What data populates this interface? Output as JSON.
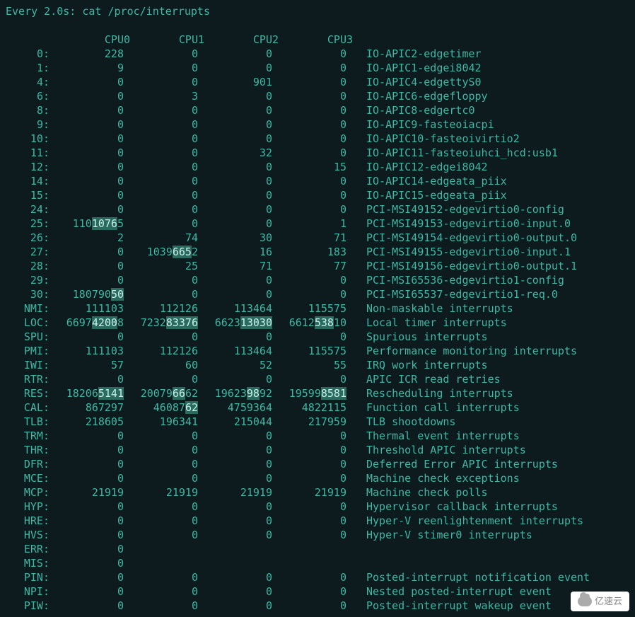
{
  "header": "Every 2.0s: cat /proc/interrupts",
  "cpu_headers": [
    "CPU0",
    "CPU1",
    "CPU2",
    "CPU3"
  ],
  "rows": [
    {
      "label": "0:",
      "cpu": [
        {
          "t": "228"
        },
        {
          "t": "0"
        },
        {
          "t": "0"
        },
        {
          "t": "0"
        }
      ],
      "src": "IO-APIC",
      "edge": "2-edge",
      "dev": "timer"
    },
    {
      "label": "1:",
      "cpu": [
        {
          "t": "9"
        },
        {
          "t": "0"
        },
        {
          "t": "0"
        },
        {
          "t": "0"
        }
      ],
      "src": "IO-APIC",
      "edge": "1-edge",
      "dev": "i8042"
    },
    {
      "label": "4:",
      "cpu": [
        {
          "t": "0"
        },
        {
          "t": "0"
        },
        {
          "t": "901"
        },
        {
          "t": "0"
        }
      ],
      "src": "IO-APIC",
      "edge": "4-edge",
      "dev": "ttyS0"
    },
    {
      "label": "6:",
      "cpu": [
        {
          "t": "0"
        },
        {
          "t": "3"
        },
        {
          "t": "0"
        },
        {
          "t": "0"
        }
      ],
      "src": "IO-APIC",
      "edge": "6-edge",
      "dev": "floppy"
    },
    {
      "label": "8:",
      "cpu": [
        {
          "t": "0"
        },
        {
          "t": "0"
        },
        {
          "t": "0"
        },
        {
          "t": "0"
        }
      ],
      "src": "IO-APIC",
      "edge": "8-edge",
      "dev": "rtc0"
    },
    {
      "label": "9:",
      "cpu": [
        {
          "t": "0"
        },
        {
          "t": "0"
        },
        {
          "t": "0"
        },
        {
          "t": "0"
        }
      ],
      "src": "IO-APIC",
      "edge": "9-fasteoi",
      "dev": "acpi"
    },
    {
      "label": "10:",
      "cpu": [
        {
          "t": "0"
        },
        {
          "t": "0"
        },
        {
          "t": "0"
        },
        {
          "t": "0"
        }
      ],
      "src": "IO-APIC",
      "edge": "10-fasteoi",
      "dev": "virtio2"
    },
    {
      "label": "11:",
      "cpu": [
        {
          "t": "0"
        },
        {
          "t": "0"
        },
        {
          "t": "32"
        },
        {
          "t": "0"
        }
      ],
      "src": "IO-APIC",
      "edge": "11-fasteoi",
      "dev": "uhci_hcd:usb1"
    },
    {
      "label": "12:",
      "cpu": [
        {
          "t": "0"
        },
        {
          "t": "0"
        },
        {
          "t": "0"
        },
        {
          "t": "15"
        }
      ],
      "src": "IO-APIC",
      "edge": "12-edge",
      "dev": "i8042"
    },
    {
      "label": "14:",
      "cpu": [
        {
          "t": "0"
        },
        {
          "t": "0"
        },
        {
          "t": "0"
        },
        {
          "t": "0"
        }
      ],
      "src": "IO-APIC",
      "edge": "14-edge",
      "dev": "ata_piix"
    },
    {
      "label": "15:",
      "cpu": [
        {
          "t": "0"
        },
        {
          "t": "0"
        },
        {
          "t": "0"
        },
        {
          "t": "0"
        }
      ],
      "src": "IO-APIC",
      "edge": "15-edge",
      "dev": "ata_piix"
    },
    {
      "label": "24:",
      "cpu": [
        {
          "t": "0"
        },
        {
          "t": "0"
        },
        {
          "t": "0"
        },
        {
          "t": "0"
        }
      ],
      "src": "PCI-MSI",
      "edge": "49152-edge",
      "dev": "virtio0-config",
      "wide": true
    },
    {
      "label": "25:",
      "cpu": [
        {
          "p": "110",
          "h": "1076",
          "s": "5"
        },
        {
          "t": "0"
        },
        {
          "t": "0"
        },
        {
          "t": "1"
        }
      ],
      "src": "PCI-MSI",
      "edge": "49153-edge",
      "dev": "virtio0-input.0",
      "wide": true
    },
    {
      "label": "26:",
      "cpu": [
        {
          "t": "2"
        },
        {
          "t": "74"
        },
        {
          "t": "30"
        },
        {
          "t": "71"
        }
      ],
      "src": "PCI-MSI",
      "edge": "49154-edge",
      "dev": "virtio0-output.0",
      "wide": true
    },
    {
      "label": "27:",
      "cpu": [
        {
          "t": "0"
        },
        {
          "p": "1039",
          "h": "665",
          "s": "2"
        },
        {
          "t": "16"
        },
        {
          "t": "183"
        }
      ],
      "src": "PCI-MSI",
      "edge": "49155-edge",
      "dev": "virtio0-input.1",
      "wide": true
    },
    {
      "label": "28:",
      "cpu": [
        {
          "t": "0"
        },
        {
          "t": "25"
        },
        {
          "t": "71"
        },
        {
          "t": "77"
        }
      ],
      "src": "PCI-MSI",
      "edge": "49156-edge",
      "dev": "virtio0-output.1",
      "wide": true
    },
    {
      "label": "29:",
      "cpu": [
        {
          "t": "0"
        },
        {
          "t": "0"
        },
        {
          "t": "0"
        },
        {
          "t": "0"
        }
      ],
      "src": "PCI-MSI",
      "edge": "65536-edge",
      "dev": "virtio1-config",
      "wide": true
    },
    {
      "label": "30:",
      "cpu": [
        {
          "p": "180790",
          "h": "50",
          "s": ""
        },
        {
          "t": "0"
        },
        {
          "t": "0"
        },
        {
          "t": "0"
        }
      ],
      "src": "PCI-MSI",
      "edge": "65537-edge",
      "dev": "virtio1-req.0",
      "wide": true
    },
    {
      "label": "NMI:",
      "cpu": [
        {
          "t": "111103"
        },
        {
          "t": "112126"
        },
        {
          "t": "113464"
        },
        {
          "t": "115575"
        }
      ],
      "desc": "Non-maskable interrupts"
    },
    {
      "label": "LOC:",
      "cpu": [
        {
          "p": "6697",
          "h": "4200",
          "s": "8"
        },
        {
          "p": "7232",
          "h": "83376",
          "s": ""
        },
        {
          "p": "6623",
          "h": "13030",
          "s": ""
        },
        {
          "p": "6612",
          "h": "538",
          "s": "10"
        }
      ],
      "desc": "Local timer interrupts"
    },
    {
      "label": "SPU:",
      "cpu": [
        {
          "t": "0"
        },
        {
          "t": "0"
        },
        {
          "t": "0"
        },
        {
          "t": "0"
        }
      ],
      "desc": "Spurious interrupts"
    },
    {
      "label": "PMI:",
      "cpu": [
        {
          "t": "111103"
        },
        {
          "t": "112126"
        },
        {
          "t": "113464"
        },
        {
          "t": "115575"
        }
      ],
      "desc": "Performance monitoring interrupts"
    },
    {
      "label": "IWI:",
      "cpu": [
        {
          "t": "57"
        },
        {
          "t": "60"
        },
        {
          "t": "52"
        },
        {
          "t": "55"
        }
      ],
      "desc": "IRQ work interrupts"
    },
    {
      "label": "RTR:",
      "cpu": [
        {
          "t": "0"
        },
        {
          "t": "0"
        },
        {
          "t": "0"
        },
        {
          "t": "0"
        }
      ],
      "desc": "APIC ICR read retries"
    },
    {
      "label": "RES:",
      "cpu": [
        {
          "p": "18206",
          "h": "5141",
          "s": ""
        },
        {
          "p": "20079",
          "h": "66",
          "s": "62"
        },
        {
          "p": "19623",
          "h": "98",
          "s": "92"
        },
        {
          "p": "19599",
          "h": "8581",
          "s": ""
        }
      ],
      "desc": "Rescheduling interrupts"
    },
    {
      "label": "CAL:",
      "cpu": [
        {
          "t": "867297"
        },
        {
          "p": "46087",
          "h": "62",
          "s": ""
        },
        {
          "t": "4759364"
        },
        {
          "t": "4822115"
        }
      ],
      "desc": "Function call interrupts"
    },
    {
      "label": "TLB:",
      "cpu": [
        {
          "t": "218605"
        },
        {
          "t": "196341"
        },
        {
          "t": "215044"
        },
        {
          "t": "217959"
        }
      ],
      "desc": "TLB shootdowns"
    },
    {
      "label": "TRM:",
      "cpu": [
        {
          "t": "0"
        },
        {
          "t": "0"
        },
        {
          "t": "0"
        },
        {
          "t": "0"
        }
      ],
      "desc": "Thermal event interrupts"
    },
    {
      "label": "THR:",
      "cpu": [
        {
          "t": "0"
        },
        {
          "t": "0"
        },
        {
          "t": "0"
        },
        {
          "t": "0"
        }
      ],
      "desc": "Threshold APIC interrupts"
    },
    {
      "label": "DFR:",
      "cpu": [
        {
          "t": "0"
        },
        {
          "t": "0"
        },
        {
          "t": "0"
        },
        {
          "t": "0"
        }
      ],
      "desc": "Deferred Error APIC interrupts"
    },
    {
      "label": "MCE:",
      "cpu": [
        {
          "t": "0"
        },
        {
          "t": "0"
        },
        {
          "t": "0"
        },
        {
          "t": "0"
        }
      ],
      "desc": "Machine check exceptions"
    },
    {
      "label": "MCP:",
      "cpu": [
        {
          "t": "21919"
        },
        {
          "t": "21919"
        },
        {
          "t": "21919"
        },
        {
          "t": "21919"
        }
      ],
      "desc": "Machine check polls"
    },
    {
      "label": "HYP:",
      "cpu": [
        {
          "t": "0"
        },
        {
          "t": "0"
        },
        {
          "t": "0"
        },
        {
          "t": "0"
        }
      ],
      "desc": "Hypervisor callback interrupts"
    },
    {
      "label": "HRE:",
      "cpu": [
        {
          "t": "0"
        },
        {
          "t": "0"
        },
        {
          "t": "0"
        },
        {
          "t": "0"
        }
      ],
      "desc": "Hyper-V reenlightenment interrupts"
    },
    {
      "label": "HVS:",
      "cpu": [
        {
          "t": "0"
        },
        {
          "t": "0"
        },
        {
          "t": "0"
        },
        {
          "t": "0"
        }
      ],
      "desc": "Hyper-V stimer0 interrupts"
    },
    {
      "label": "ERR:",
      "cpu": [
        {
          "t": "0"
        }
      ]
    },
    {
      "label": "MIS:",
      "cpu": [
        {
          "t": "0"
        }
      ]
    },
    {
      "label": "PIN:",
      "cpu": [
        {
          "t": "0"
        },
        {
          "t": "0"
        },
        {
          "t": "0"
        },
        {
          "t": "0"
        }
      ],
      "desc": "Posted-interrupt notification event"
    },
    {
      "label": "NPI:",
      "cpu": [
        {
          "t": "0"
        },
        {
          "t": "0"
        },
        {
          "t": "0"
        },
        {
          "t": "0"
        }
      ],
      "desc": "Nested posted-interrupt event"
    },
    {
      "label": "PIW:",
      "cpu": [
        {
          "t": "0"
        },
        {
          "t": "0"
        },
        {
          "t": "0"
        },
        {
          "t": "0"
        }
      ],
      "desc": "Posted-interrupt wakeup event"
    }
  ],
  "watermark": "亿速云"
}
